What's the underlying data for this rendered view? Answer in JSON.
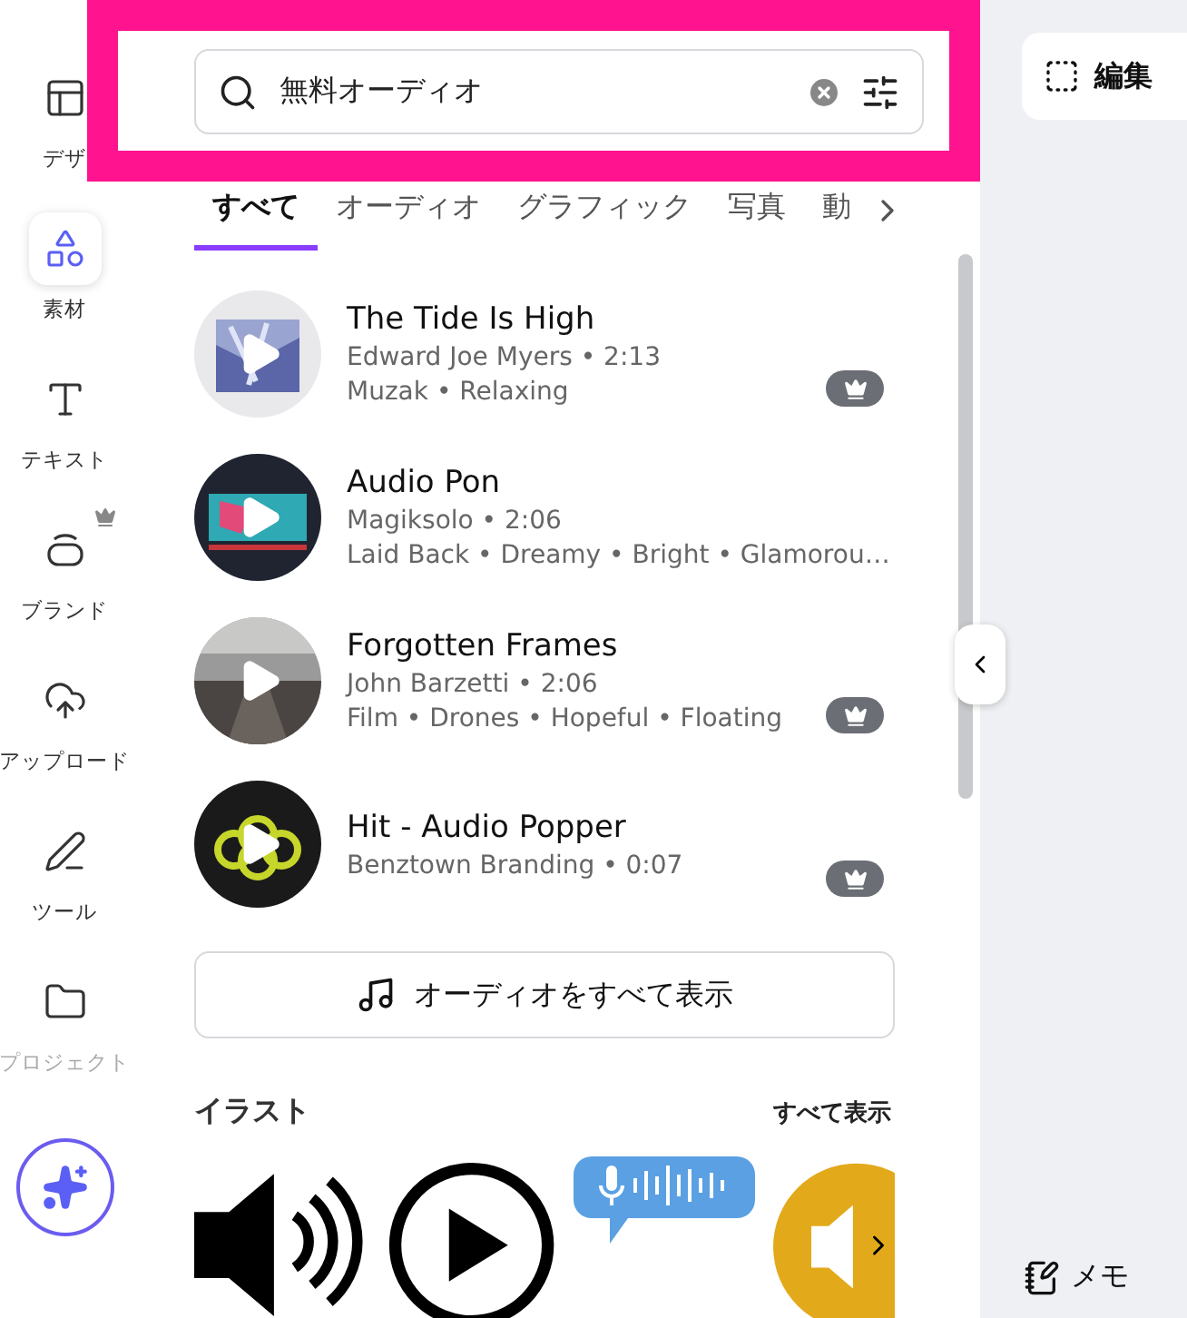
{
  "search": {
    "value": "無料オーディオ"
  },
  "nav": [
    {
      "label": "デザ",
      "selected": false,
      "crown": false,
      "dimmed": false
    },
    {
      "label": "素材",
      "selected": true,
      "crown": false,
      "dimmed": false
    },
    {
      "label": "テキスト",
      "selected": false,
      "crown": false,
      "dimmed": false
    },
    {
      "label": "ブランド",
      "selected": false,
      "crown": true,
      "dimmed": false
    },
    {
      "label": "アップロード",
      "selected": false,
      "crown": false,
      "dimmed": false
    },
    {
      "label": "ツール",
      "selected": false,
      "crown": false,
      "dimmed": false
    },
    {
      "label": "プロジェクト",
      "selected": false,
      "crown": false,
      "dimmed": true
    }
  ],
  "tabs": [
    {
      "label": "すべて",
      "selected": true
    },
    {
      "label": "オーディオ",
      "selected": false
    },
    {
      "label": "グラフィック",
      "selected": false
    },
    {
      "label": "写真",
      "selected": false
    },
    {
      "label": "動",
      "selected": false
    }
  ],
  "tracks": [
    {
      "title": "The Tide Is High",
      "byline": "Edward Joe Myers • 2:13",
      "tags": "Muzak • Relaxing",
      "premium": true
    },
    {
      "title": "Audio Pon",
      "byline": "Magiksolo • 2:06",
      "tags": "Laid Back • Dreamy • Bright • Glamorou…",
      "premium": false
    },
    {
      "title": "Forgotten Frames",
      "byline": "John Barzetti • 2:06",
      "tags": "Film • Drones • Hopeful • Floating",
      "premium": true
    },
    {
      "title": "Hit - Audio Popper",
      "byline": "Benztown Branding • 0:07",
      "premium": true
    }
  ],
  "all_audio_button": "オーディオをすべて表示",
  "illustrations": {
    "title": "イラスト",
    "see_all": "すべて表示"
  },
  "edit_button": "編集",
  "memo_button": "メモ"
}
